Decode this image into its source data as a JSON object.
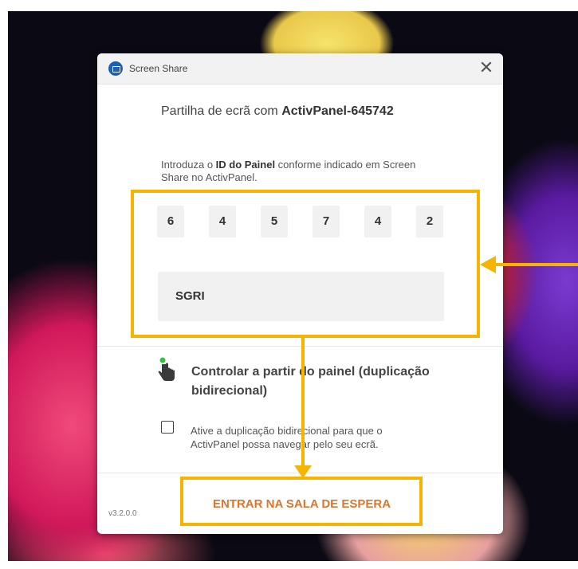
{
  "window": {
    "title": "Screen Share",
    "close_glyph": "✕",
    "app_icon": "screen-share-icon"
  },
  "heading": {
    "prefix": "Partilha de ecrã com ",
    "panel_name": "ActivPanel-645742"
  },
  "instructions": {
    "part1": "Introduza o ",
    "bold": "ID do Painel",
    "part2": " conforme indicado em Screen Share no ActivPanel."
  },
  "panel_id_digits": [
    "6",
    "4",
    "5",
    "7",
    "4",
    "2"
  ],
  "name_field": {
    "value": "SGRI"
  },
  "control": {
    "title": "Controlar a partir do painel (duplicação bidirecional)",
    "icon": "touch-hand-icon",
    "checkbox_checked": false,
    "checkbox_label": "Ative a duplicação bidirecional para que o ActivPanel possa navegar pelo seu ecrã."
  },
  "footer": {
    "version": "v3.2.0.0",
    "enter_button": "ENTRAR NA SALA DE ESPERA"
  },
  "colors": {
    "accent": "#e0742a",
    "annotation": "#f4b400",
    "app_icon": "#1d5fb8"
  }
}
